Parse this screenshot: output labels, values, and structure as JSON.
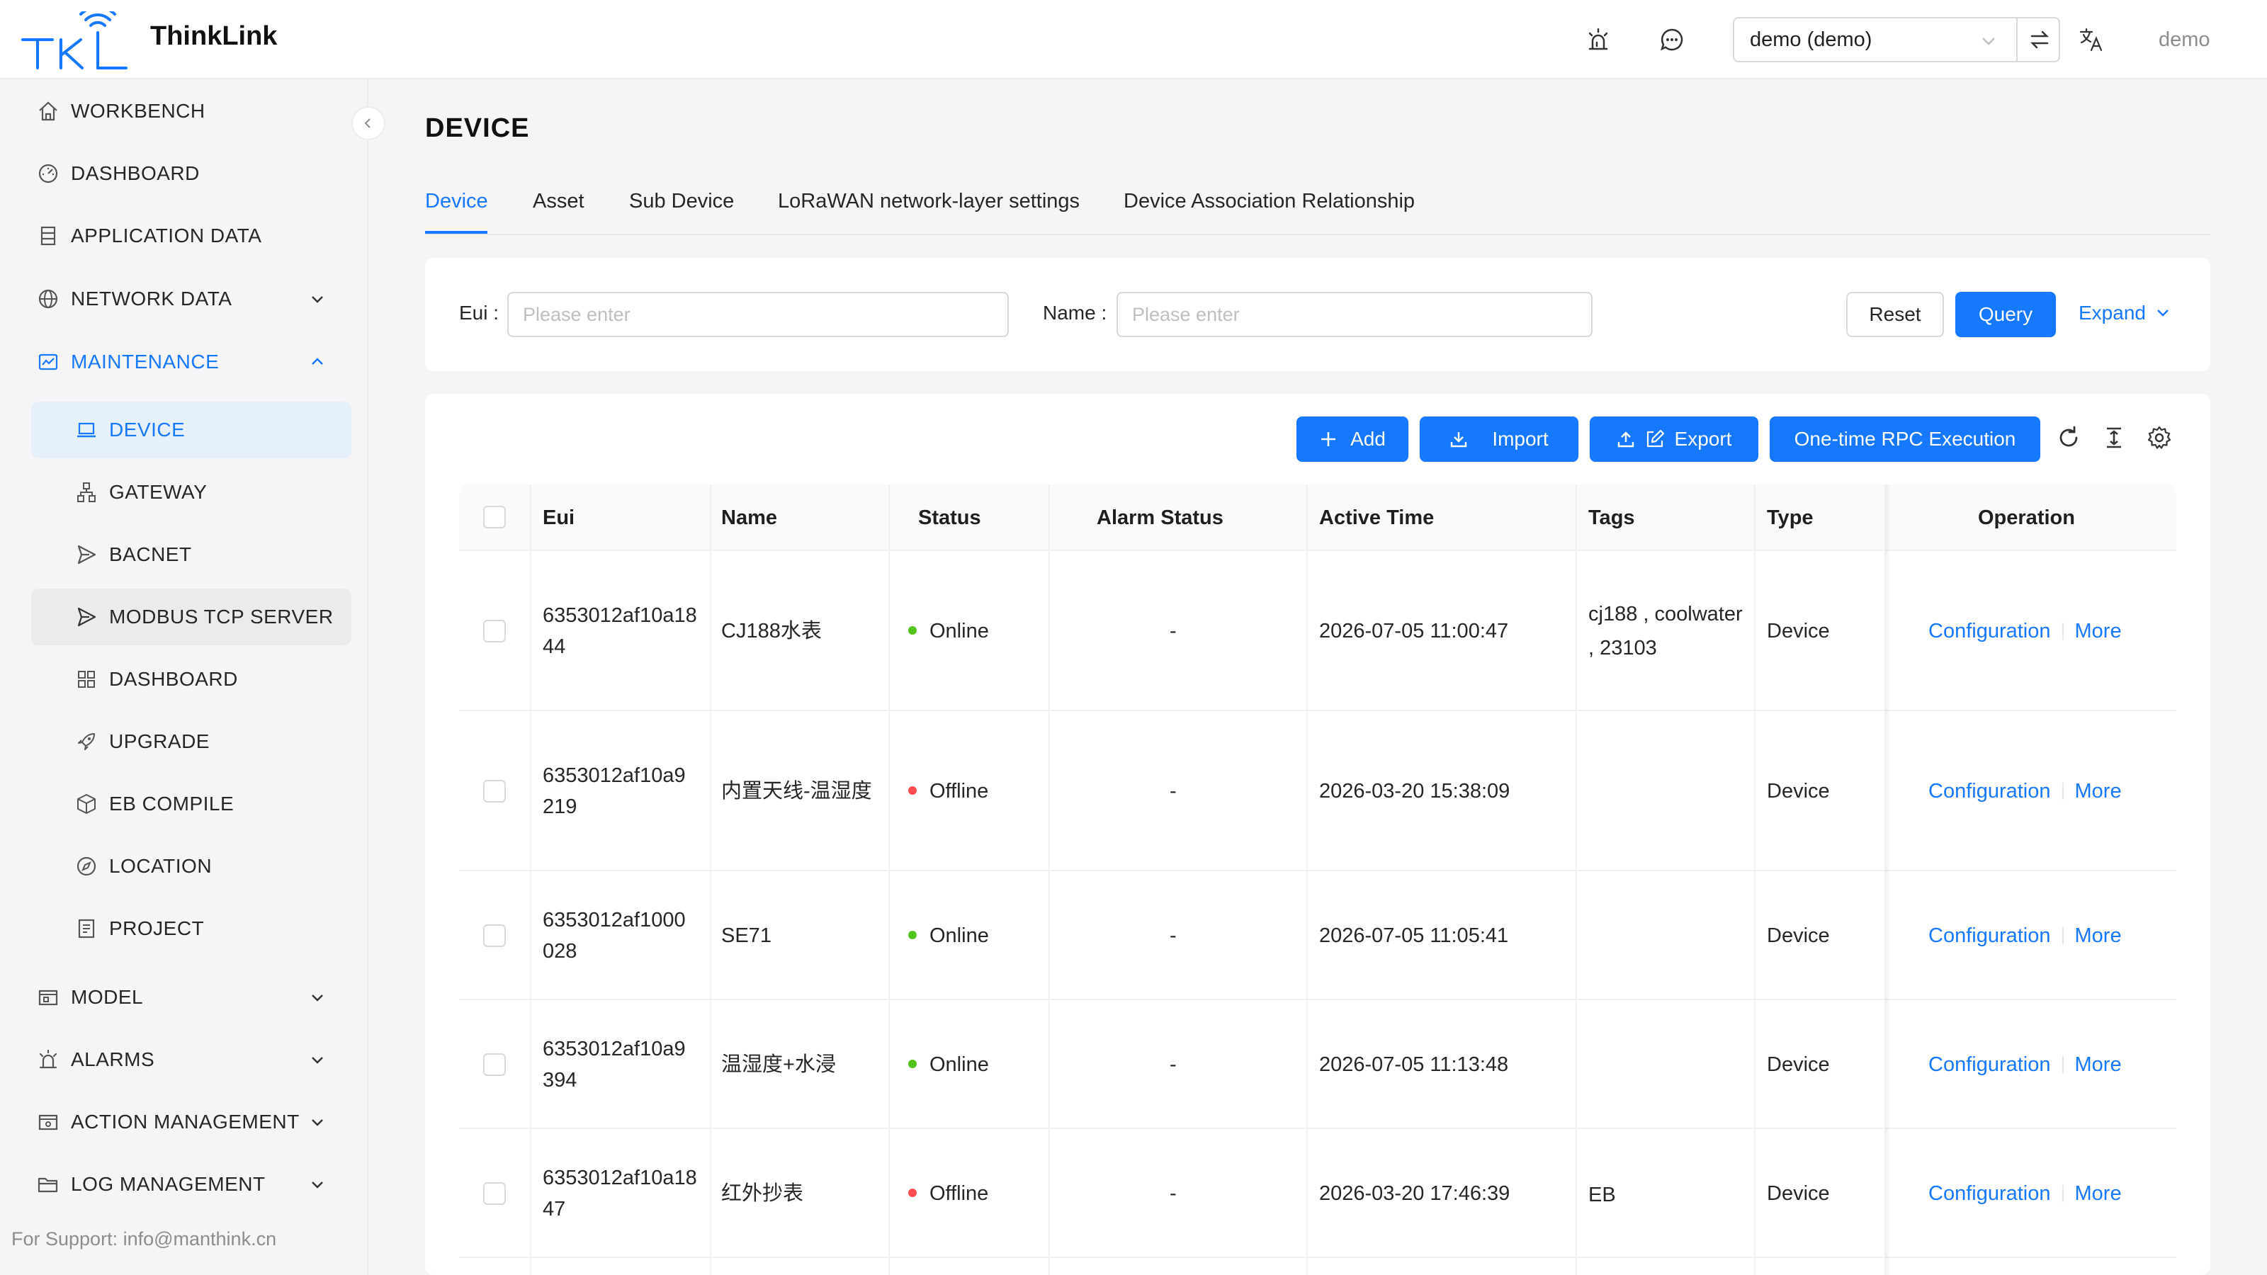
{
  "header": {
    "app_title": "ThinkLink",
    "tenant_value": "demo (demo)",
    "user": "demo"
  },
  "sidebar": {
    "items": [
      {
        "label": "WORKBENCH",
        "icon": "home-icon"
      },
      {
        "label": "DASHBOARD",
        "icon": "dashboard-icon"
      },
      {
        "label": "APPLICATION DATA",
        "icon": "database-icon"
      },
      {
        "label": "NETWORK DATA",
        "icon": "globe-icon"
      },
      {
        "label": "MAINTENANCE",
        "icon": "maintenance-icon"
      },
      {
        "label": "DEVICE",
        "icon": "laptop-icon"
      },
      {
        "label": "GATEWAY",
        "icon": "cluster-icon"
      },
      {
        "label": "BACNET",
        "icon": "send-icon"
      },
      {
        "label": "MODBUS TCP SERVER",
        "icon": "send-icon"
      },
      {
        "label": "DASHBOARD",
        "icon": "grid-icon"
      },
      {
        "label": "UPGRADE",
        "icon": "rocket-icon"
      },
      {
        "label": "EB COMPILE",
        "icon": "code-box-icon"
      },
      {
        "label": "LOCATION",
        "icon": "compass-icon"
      },
      {
        "label": "PROJECT",
        "icon": "project-icon"
      },
      {
        "label": "MODEL",
        "icon": "model-icon"
      },
      {
        "label": "ALARMS",
        "icon": "alarm-icon"
      },
      {
        "label": "ACTION MANAGEMENT",
        "icon": "action-icon"
      },
      {
        "label": "LOG MANAGEMENT",
        "icon": "folder-icon"
      }
    ],
    "support": "For Support: info@manthink.cn"
  },
  "page": {
    "title": "DEVICE",
    "tabs": [
      "Device",
      "Asset",
      "Sub Device",
      "LoRaWAN network-layer settings",
      "Device Association Relationship"
    ]
  },
  "filter": {
    "eui_label": "Eui",
    "eui_placeholder": "Please enter",
    "name_label": "Name",
    "name_placeholder": "Please enter",
    "reset": "Reset",
    "query": "Query",
    "expand": "Expand"
  },
  "toolbar": {
    "add": "Add",
    "import": "Import",
    "export": "Export",
    "rpc": "One-time RPC Execution"
  },
  "colors": {
    "primary": "#1677ff",
    "online": "#52c41a",
    "offline": "#ff4d4f"
  },
  "table": {
    "columns": [
      "Eui",
      "Name",
      "Status",
      "Alarm Status",
      "Active Time",
      "Tags",
      "Type",
      "Operation"
    ],
    "rows": [
      {
        "eui_1": "6353012af10a18",
        "eui_2": "44",
        "name": "CJ188水表",
        "status": "Online",
        "alarm": "-",
        "active_time": "2026-07-05 11:00:47",
        "tags_1": "cj188 , coolwater",
        "tags_2": ", 23103",
        "type": "Device",
        "op_config": "Configuration",
        "op_more": "More"
      },
      {
        "eui_1": "6353012af10a9",
        "eui_2": "219",
        "name": "内置天线-温湿度",
        "status": "Offline",
        "alarm": "-",
        "active_time": "2026-03-20 15:38:09",
        "tags_1": "",
        "tags_2": "",
        "type": "Device",
        "op_config": "Configuration",
        "op_more": "More"
      },
      {
        "eui_1": "6353012af1000",
        "eui_2": "028",
        "name": "SE71",
        "status": "Online",
        "alarm": "-",
        "active_time": "2026-07-05 11:05:41",
        "tags_1": "",
        "tags_2": "",
        "type": "Device",
        "op_config": "Configuration",
        "op_more": "More"
      },
      {
        "eui_1": "6353012af10a9",
        "eui_2": "394",
        "name": "温湿度+水浸",
        "status": "Online",
        "alarm": "-",
        "active_time": "2026-07-05 11:13:48",
        "tags_1": "",
        "tags_2": "",
        "type": "Device",
        "op_config": "Configuration",
        "op_more": "More"
      },
      {
        "eui_1": "6353012af10a18",
        "eui_2": "47",
        "name": "红外抄表",
        "status": "Offline",
        "alarm": "-",
        "active_time": "2026-03-20 17:46:39",
        "tags_1": "EB",
        "tags_2": "",
        "type": "Device",
        "op_config": "Configuration",
        "op_more": "More"
      }
    ]
  }
}
